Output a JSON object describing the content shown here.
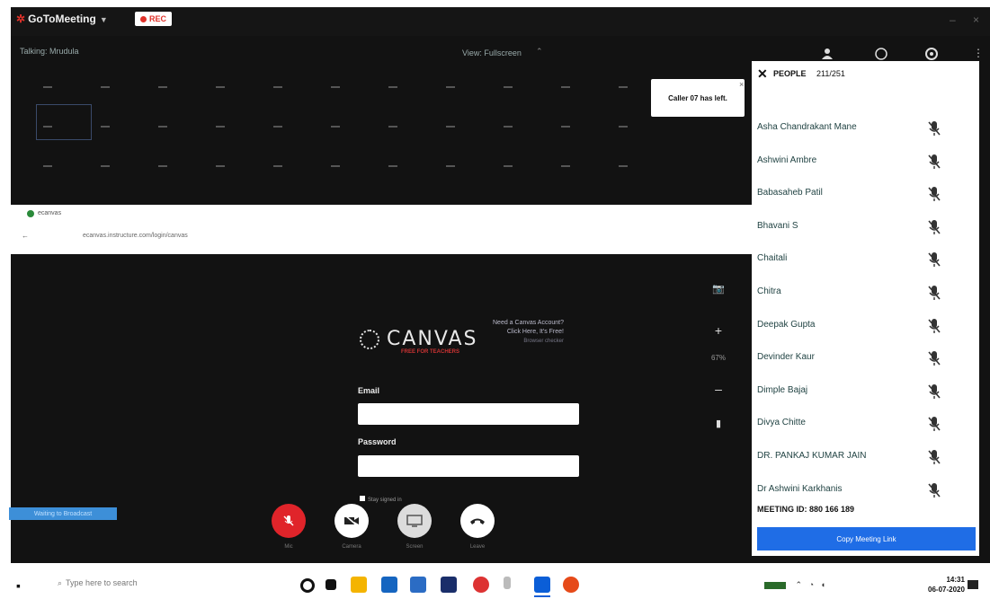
{
  "app": {
    "logo_text": "GoToMeeting",
    "rec_label": "REC"
  },
  "meeting": {
    "talking_label": "Talking: Mrudula",
    "view_label": "View: Fullscreen",
    "notice": "Caller 07 has left."
  },
  "browser": {
    "tab_label": "ecanvas",
    "address": "ecanvas.instructure.com/login/canvas"
  },
  "shared_screen": {
    "brand": "CANVAS",
    "tagline": "FREE FOR TEACHERS",
    "need_account_line1": "Need a Canvas Account?",
    "need_account_line2": "Click Here, It's Free!",
    "browser_checker": "Browser checker",
    "email_label": "Email",
    "password_label": "Password",
    "stay_signed_in": "Stay signed in",
    "zoom": "67%"
  },
  "controls": {
    "waiting_button": "Waiting to Broadcast",
    "buttons": [
      {
        "name": "mic-button",
        "label": "Mic",
        "color": "#e0242a"
      },
      {
        "name": "camera-button",
        "label": "Camera",
        "color": "#ffffff"
      },
      {
        "name": "screen-button",
        "label": "Screen",
        "color": "#dcdcdc"
      },
      {
        "name": "leave-button",
        "label": "Leave",
        "color": "#ffffff"
      }
    ]
  },
  "people_panel": {
    "title": "PEOPLE",
    "count": "211/251",
    "participants": [
      "Asha Chandrakant Mane",
      "Ashwini Ambre",
      "Babasaheb Patil",
      "Bhavani S",
      "Chaitali",
      "Chitra",
      "Deepak Gupta",
      "Devinder Kaur",
      "Dimple Bajaj",
      "Divya Chitte",
      "DR. PANKAJ KUMAR JAIN",
      "Dr Ashwini Karkhanis"
    ],
    "meeting_id": "MEETING ID: 880 166 189",
    "copy_link": "Copy Meeting Link"
  },
  "taskbar": {
    "search_placeholder": "Type here to search",
    "time": "14:31",
    "date": "06-07-2020"
  },
  "colors": {
    "brand_red": "#e0322a",
    "accent_blue": "#1f6de6",
    "mic_muted": "#e0242a"
  }
}
